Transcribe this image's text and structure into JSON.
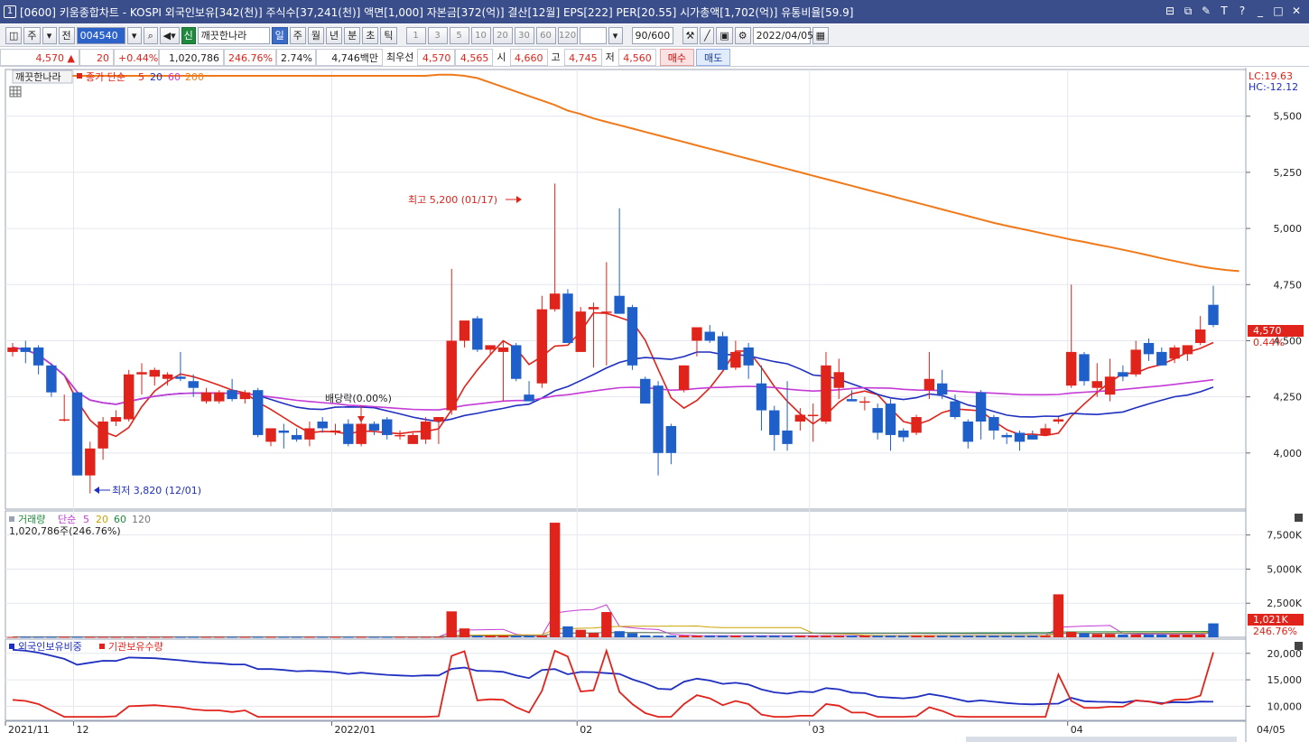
{
  "window": {
    "badge": "1",
    "title": "[0600] 키움종합차트 - KOSPI 외국인보유[342(천)] 주식수[37,241(천)] 액면[1,000] 자본금[372(억)] 결산[12월] EPS[222] PER[20.55] 시가총액[1,702(억)] 유통비율[59.9]"
  },
  "toolbar": {
    "period": "주",
    "all": "전",
    "code": "004540",
    "badge_new": "신",
    "stock_name": "깨끗한나라",
    "intervals": [
      "일",
      "주",
      "월",
      "년",
      "분",
      "초",
      "틱"
    ],
    "active_interval": "일",
    "ticks": [
      "1",
      "3",
      "5",
      "10",
      "20",
      "30",
      "60",
      "120"
    ],
    "count": "90",
    "count_total": "/600",
    "date": "2022/04/05"
  },
  "quote": {
    "price": "4,570",
    "arrow": "▲",
    "change": "20",
    "change_pct": "+0.44%",
    "volume": "1,020,786",
    "volume_ratio": "246.76%",
    "turnover": "2.74%",
    "amount": "4,746백만",
    "priority_label": "최우선",
    "ask": "4,570",
    "bid": "4,565",
    "open_label": "시",
    "open": "4,660",
    "high_label": "고",
    "high": "4,745",
    "low_label": "저",
    "low": "4,560",
    "buy_label": "매수",
    "sell_label": "매도"
  },
  "price_panel": {
    "stock_label": "깨끗한나라",
    "ma_label": "종가 단순",
    "ma_periods": [
      "5",
      "20",
      "60",
      "200"
    ],
    "ma_colors": [
      "#e0231b",
      "#1f2fbf",
      "#c43bd6",
      "#f07a1a"
    ],
    "lc": "LC:19.63",
    "hc": "HC:-12.12",
    "current_tag": "4,570",
    "current_pct": "0.44%",
    "high_note": "최고 5,200 (01/17)",
    "low_note": "최저 3,820 (12/01)",
    "dividend_note": "배당락(0.00%)",
    "y_ticks": [
      "5,500",
      "5,250",
      "5,000",
      "4,750",
      "4,500",
      "4,250",
      "4,000"
    ]
  },
  "volume_panel": {
    "label": "거래량",
    "ma_label": "단순",
    "ma_periods": [
      "5",
      "20",
      "60",
      "120"
    ],
    "ma_colors": [
      "#c43bd6",
      "#c9a400",
      "#1f8a3d",
      "#777777"
    ],
    "value": "1,020,786주(246.76%)",
    "y_ticks": [
      "7,500K",
      "5,000K",
      "2,500K"
    ],
    "current_tag": "1,021K",
    "current_pct": "246.76%"
  },
  "holdings_panel": {
    "label_foreign": "외국인보유비중",
    "label_inst": "기관보유수량",
    "y_ticks": [
      "20,000",
      "15,000",
      "10,000"
    ]
  },
  "xaxis": {
    "labels": [
      "2021/11",
      "12",
      "2022/01",
      "02",
      "03",
      "04"
    ],
    "right_label": "04/05"
  },
  "chart_data": {
    "type": "candlestick",
    "ylim": [
      3750,
      5700
    ],
    "candles": [
      {
        "o": 4450,
        "h": 4490,
        "l": 4430,
        "c": 4470
      },
      {
        "o": 4470,
        "h": 4500,
        "l": 4400,
        "c": 4450
      },
      {
        "o": 4470,
        "h": 4480,
        "l": 4350,
        "c": 4390
      },
      {
        "o": 4390,
        "h": 4400,
        "l": 4250,
        "c": 4270
      },
      {
        "o": 4150,
        "h": 4260,
        "l": 4140,
        "c": 4150
      },
      {
        "o": 4270,
        "h": 4270,
        "l": 3900,
        "c": 3900
      },
      {
        "o": 3900,
        "h": 4050,
        "l": 3820,
        "c": 4020
      },
      {
        "o": 4020,
        "h": 4160,
        "l": 3970,
        "c": 4140
      },
      {
        "o": 4140,
        "h": 4190,
        "l": 4120,
        "c": 4160
      },
      {
        "o": 4150,
        "h": 4370,
        "l": 4140,
        "c": 4350
      },
      {
        "o": 4350,
        "h": 4400,
        "l": 4260,
        "c": 4360
      },
      {
        "o": 4340,
        "h": 4380,
        "l": 4300,
        "c": 4370
      },
      {
        "o": 4330,
        "h": 4360,
        "l": 4300,
        "c": 4350
      },
      {
        "o": 4340,
        "h": 4450,
        "l": 4320,
        "c": 4330
      },
      {
        "o": 4320,
        "h": 4350,
        "l": 4250,
        "c": 4290
      },
      {
        "o": 4230,
        "h": 4290,
        "l": 4220,
        "c": 4270
      },
      {
        "o": 4230,
        "h": 4280,
        "l": 4220,
        "c": 4270
      },
      {
        "o": 4280,
        "h": 4330,
        "l": 4230,
        "c": 4240
      },
      {
        "o": 4240,
        "h": 4280,
        "l": 4220,
        "c": 4270
      },
      {
        "o": 4280,
        "h": 4290,
        "l": 4070,
        "c": 4080
      },
      {
        "o": 4050,
        "h": 4100,
        "l": 4030,
        "c": 4110
      },
      {
        "o": 4100,
        "h": 4130,
        "l": 4020,
        "c": 4090
      },
      {
        "o": 4080,
        "h": 4110,
        "l": 4050,
        "c": 4060
      },
      {
        "o": 4060,
        "h": 4140,
        "l": 4030,
        "c": 4110
      },
      {
        "o": 4140,
        "h": 4160,
        "l": 4090,
        "c": 4110
      },
      {
        "o": 4100,
        "h": 4130,
        "l": 4080,
        "c": 4100
      },
      {
        "o": 4130,
        "h": 4150,
        "l": 4030,
        "c": 4040
      },
      {
        "o": 4040,
        "h": 4140,
        "l": 4030,
        "c": 4130
      },
      {
        "o": 4130,
        "h": 4140,
        "l": 4080,
        "c": 4100
      },
      {
        "o": 4150,
        "h": 4160,
        "l": 4060,
        "c": 4080
      },
      {
        "o": 4080,
        "h": 4100,
        "l": 4060,
        "c": 4080
      },
      {
        "o": 4040,
        "h": 4090,
        "l": 4040,
        "c": 4080
      },
      {
        "o": 4060,
        "h": 4160,
        "l": 4040,
        "c": 4140
      },
      {
        "o": 4140,
        "h": 4160,
        "l": 4040,
        "c": 4160
      },
      {
        "o": 4190,
        "h": 4820,
        "l": 4170,
        "c": 4500
      },
      {
        "o": 4500,
        "h": 4510,
        "l": 4470,
        "c": 4590
      },
      {
        "o": 4600,
        "h": 4610,
        "l": 4450,
        "c": 4460
      },
      {
        "o": 4460,
        "h": 4480,
        "l": 4440,
        "c": 4480
      },
      {
        "o": 4450,
        "h": 4500,
        "l": 4230,
        "c": 4470
      },
      {
        "o": 4480,
        "h": 4490,
        "l": 4320,
        "c": 4330
      },
      {
        "o": 4260,
        "h": 4320,
        "l": 4240,
        "c": 4230
      },
      {
        "o": 4310,
        "h": 4700,
        "l": 4290,
        "c": 4640
      },
      {
        "o": 4640,
        "h": 5200,
        "l": 4630,
        "c": 4710
      },
      {
        "o": 4710,
        "h": 4730,
        "l": 4640,
        "c": 4490
      },
      {
        "o": 4450,
        "h": 4650,
        "l": 4450,
        "c": 4630
      },
      {
        "o": 4640,
        "h": 4670,
        "l": 4380,
        "c": 4650
      },
      {
        "o": 4630,
        "h": 4850,
        "l": 4390,
        "c": 4630
      },
      {
        "o": 4700,
        "h": 5090,
        "l": 4690,
        "c": 4620
      },
      {
        "o": 4650,
        "h": 4660,
        "l": 4370,
        "c": 4390
      },
      {
        "o": 4330,
        "h": 4340,
        "l": 4220,
        "c": 4220
      },
      {
        "o": 4300,
        "h": 4320,
        "l": 3900,
        "c": 4000
      },
      {
        "o": 4120,
        "h": 4130,
        "l": 3950,
        "c": 4000
      },
      {
        "o": 4280,
        "h": 4390,
        "l": 4270,
        "c": 4390
      },
      {
        "o": 4500,
        "h": 4550,
        "l": 4430,
        "c": 4560
      },
      {
        "o": 4540,
        "h": 4570,
        "l": 4490,
        "c": 4500
      },
      {
        "o": 4520,
        "h": 4540,
        "l": 4380,
        "c": 4370
      },
      {
        "o": 4380,
        "h": 4500,
        "l": 4370,
        "c": 4450
      },
      {
        "o": 4470,
        "h": 4490,
        "l": 4330,
        "c": 4390
      },
      {
        "o": 4310,
        "h": 4390,
        "l": 4100,
        "c": 4190
      },
      {
        "o": 4190,
        "h": 4210,
        "l": 4010,
        "c": 4080
      },
      {
        "o": 4100,
        "h": 4320,
        "l": 4010,
        "c": 4040
      },
      {
        "o": 4140,
        "h": 4200,
        "l": 4100,
        "c": 4170
      },
      {
        "o": 4170,
        "h": 4220,
        "l": 4050,
        "c": 4170
      },
      {
        "o": 4140,
        "h": 4450,
        "l": 4130,
        "c": 4390
      },
      {
        "o": 4290,
        "h": 4420,
        "l": 4240,
        "c": 4360
      },
      {
        "o": 4240,
        "h": 4280,
        "l": 4230,
        "c": 4230
      },
      {
        "o": 4230,
        "h": 4250,
        "l": 4190,
        "c": 4230
      },
      {
        "o": 4200,
        "h": 4220,
        "l": 4060,
        "c": 4090
      },
      {
        "o": 4220,
        "h": 4240,
        "l": 4010,
        "c": 4080
      },
      {
        "o": 4100,
        "h": 4110,
        "l": 4050,
        "c": 4070
      },
      {
        "o": 4090,
        "h": 4170,
        "l": 4080,
        "c": 4160
      },
      {
        "o": 4280,
        "h": 4450,
        "l": 4240,
        "c": 4330
      },
      {
        "o": 4310,
        "h": 4370,
        "l": 4240,
        "c": 4260
      },
      {
        "o": 4230,
        "h": 4260,
        "l": 4150,
        "c": 4160
      },
      {
        "o": 4140,
        "h": 4150,
        "l": 4020,
        "c": 4050
      },
      {
        "o": 4270,
        "h": 4280,
        "l": 4060,
        "c": 4140
      },
      {
        "o": 4160,
        "h": 4170,
        "l": 4060,
        "c": 4100
      },
      {
        "o": 4080,
        "h": 4090,
        "l": 4040,
        "c": 4070
      },
      {
        "o": 4090,
        "h": 4100,
        "l": 4010,
        "c": 4050
      },
      {
        "o": 4080,
        "h": 4100,
        "l": 4060,
        "c": 4060
      },
      {
        "o": 4080,
        "h": 4130,
        "l": 4080,
        "c": 4110
      },
      {
        "o": 4140,
        "h": 4160,
        "l": 4130,
        "c": 4150
      },
      {
        "o": 4300,
        "h": 4750,
        "l": 4290,
        "c": 4450
      },
      {
        "o": 4440,
        "h": 4450,
        "l": 4300,
        "c": 4320
      },
      {
        "o": 4290,
        "h": 4400,
        "l": 4250,
        "c": 4320
      },
      {
        "o": 4260,
        "h": 4420,
        "l": 4230,
        "c": 4340
      },
      {
        "o": 4360,
        "h": 4390,
        "l": 4320,
        "c": 4340
      },
      {
        "o": 4350,
        "h": 4500,
        "l": 4340,
        "c": 4460
      },
      {
        "o": 4490,
        "h": 4510,
        "l": 4410,
        "c": 4440
      },
      {
        "o": 4450,
        "h": 4470,
        "l": 4390,
        "c": 4390
      },
      {
        "o": 4420,
        "h": 4480,
        "l": 4400,
        "c": 4470
      },
      {
        "o": 4440,
        "h": 4480,
        "l": 4410,
        "c": 4480
      },
      {
        "o": 4490,
        "h": 4610,
        "l": 4480,
        "c": 4550
      },
      {
        "o": 4660,
        "h": 4745,
        "l": 4560,
        "c": 4570
      }
    ],
    "ma200": [
      5680,
      5680,
      5680,
      5680,
      5680,
      5680,
      5680,
      5680,
      5680,
      5680,
      5680,
      5680,
      5680,
      5680,
      5680,
      5680,
      5680,
      5680,
      5680,
      5680,
      5680,
      5680,
      5680,
      5680,
      5680,
      5680,
      5680,
      5680,
      5680,
      5680,
      5680,
      5680,
      5680,
      5685,
      5685,
      5680,
      5670,
      5650,
      5630,
      5610,
      5590,
      5570,
      5550,
      5525,
      5510,
      5490,
      5475,
      5460,
      5445,
      5430,
      5415,
      5400,
      5385,
      5370,
      5355,
      5340,
      5325,
      5310,
      5295,
      5280,
      5265,
      5250,
      5235,
      5220,
      5205,
      5190,
      5175,
      5160,
      5145,
      5130,
      5115,
      5100,
      5085,
      5070,
      5055,
      5040,
      5025,
      5012,
      5000,
      4988,
      4975,
      4963,
      4950,
      4940,
      4928,
      4917,
      4905,
      4893,
      4880,
      4867,
      4855,
      4843,
      4831,
      4822,
      4815,
      4810
    ],
    "volume_ylim": [
      0,
      9000
    ],
    "volume": [
      30,
      30,
      30,
      30,
      30,
      30,
      30,
      30,
      30,
      30,
      30,
      30,
      30,
      30,
      30,
      30,
      30,
      30,
      30,
      30,
      30,
      30,
      30,
      30,
      30,
      30,
      30,
      30,
      30,
      30,
      30,
      30,
      30,
      30,
      1900,
      650,
      120,
      120,
      120,
      120,
      120,
      120,
      8400,
      800,
      550,
      320,
      1850,
      450,
      300,
      140,
      120,
      120,
      120,
      120,
      120,
      120,
      120,
      120,
      120,
      120,
      120,
      120,
      120,
      120,
      120,
      120,
      120,
      120,
      120,
      120,
      120,
      120,
      120,
      120,
      120,
      120,
      120,
      120,
      120,
      120,
      120,
      3150,
      400,
      300,
      250,
      250,
      200,
      200,
      200,
      200,
      200,
      200,
      200,
      1021
    ],
    "holdings_ylim": [
      7500,
      21500
    ]
  }
}
